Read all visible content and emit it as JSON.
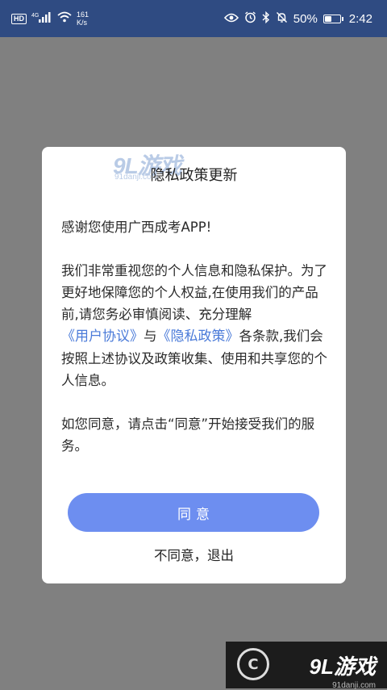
{
  "status_bar": {
    "hd_badge": "HD",
    "network": "4G",
    "speed_value": "161",
    "speed_unit": "K/s",
    "battery_percent": "50%",
    "battery_level": 0.5,
    "time": "2:42"
  },
  "watermark": {
    "top_logo": "9L游戏",
    "top_site": "91danji.com",
    "corner_logo": "9L游戏",
    "corner_site": "91danji.com",
    "corner_circle": "C"
  },
  "dialog": {
    "title": "隐私政策更新",
    "greeting": "感谢您使用广西成考APP!",
    "para2_part1": "我们非常重视您的个人信息和隐私保护。为了更好地保障您的个人权益,在使用我们的产品前,请您务必审慎阅读、充分理解",
    "link_user_agreement": "《用户协议》",
    "para2_and": "与",
    "link_privacy_policy": "《隐私政策》",
    "para2_part2": "各条款,我们会按照上述协议及政策收集、使用和共享您的个人信息。",
    "para3": "如您同意，请点击“同意”开始接受我们的服务。",
    "agree_label": "同意",
    "disagree_label": "不同意，退出"
  },
  "colors": {
    "status_bar_bg": "#2f4b82",
    "overlay_bg": "#808080",
    "link": "#4b7bd9",
    "primary_button": "#6d8ef0"
  }
}
